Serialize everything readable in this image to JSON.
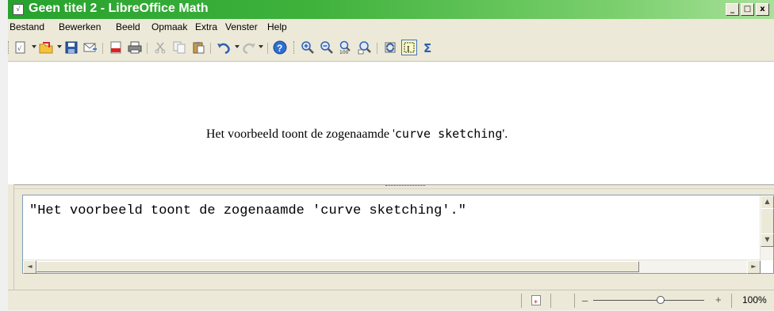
{
  "window": {
    "title": "Geen titel 2 - LibreOffice Math",
    "controls": {
      "minimize": "_",
      "maximize": "□",
      "close": "x"
    }
  },
  "menu": {
    "items": [
      {
        "label": "Bestand"
      },
      {
        "label": "Bewerken"
      },
      {
        "label": "Beeld"
      },
      {
        "label": "Opmaak"
      },
      {
        "label": "Extra"
      },
      {
        "label": "Venster"
      },
      {
        "label": "Help"
      }
    ]
  },
  "toolbar": {
    "icons": [
      "new-icon",
      "open-icon",
      "save-icon",
      "email-icon",
      "pdf-icon",
      "print-icon",
      "cut-icon",
      "copy-icon",
      "paste-icon",
      "undo-icon",
      "redo-icon",
      "help-icon",
      "zoom-in-icon",
      "zoom-out-icon",
      "zoom-100-icon",
      "show-all-icon",
      "update-icon",
      "formula-cursor-icon",
      "symbols-icon"
    ]
  },
  "formula": {
    "text_before": "Het voorbeeld toont de zogenaamde '",
    "text_mono": "curve sketching",
    "text_after": "'."
  },
  "editor": {
    "content": "\"Het voorbeeld toont de zogenaamde 'curve sketching'.\""
  },
  "statusbar": {
    "zoom": "100%",
    "zoom_level": 1.0
  },
  "colors": {
    "titlebar_start": "#27a22e",
    "titlebar_end": "#a9e09a",
    "chrome": "#ece9d8"
  }
}
